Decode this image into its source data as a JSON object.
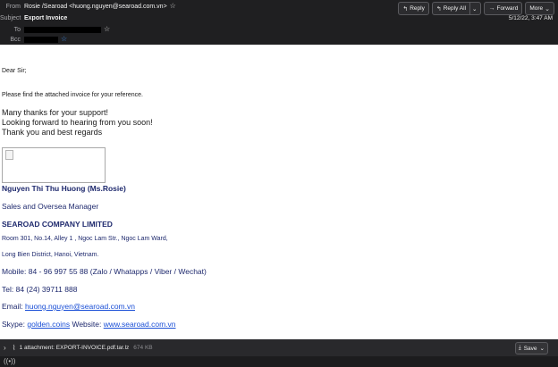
{
  "header": {
    "from_label": "From",
    "from_value": "Rosie /Searoad <huong.nguyen@searoad.com.vn>",
    "subject_label": "Subject",
    "subject_value": "Export Invoice",
    "to_label": "To",
    "bcc_label": "Bcc",
    "date": "5/12/22, 3:47 AM"
  },
  "toolbar": {
    "reply_label": "Reply",
    "reply_all_label": "Reply All",
    "forward_label": "Forward",
    "more_label": "More"
  },
  "body": {
    "greeting": "Dear Sir;",
    "intro": "Please find the attached invoice for your reference.",
    "line1": "Many thanks for your support!",
    "line2": "Looking forward to hearing from you soon!",
    "line3": "Thank you and best regards",
    "signature": {
      "name": "Nguyen Thi Thu Huong (Ms.Rosie)",
      "title": "Sales and Oversea Manager",
      "company": "SEAROAD COMPANY LIMITED",
      "address1": "Room 301, No.14, Alley 1 , Ngoc Lam Str., Ngoc Lam Ward,",
      "address2": "Long Bien District, Hanoi, Vietnam.",
      "mobile": "Mobile: 84 - 96 997 55 88 (Zalo / Whatapps / Viber / Wechat)",
      "tel": "Tel: 84 (24) 39711 888",
      "email_prefix": "Email: ",
      "email": "huong.nguyen@searoad.com.vn",
      "skype_prefix": "Skype: ",
      "skype": "golden.coins",
      "website_prefix": " Website: ",
      "website": "www.searoad.com.vn"
    }
  },
  "attachment": {
    "label": "1 attachment: EXPORT-INVOICE.pdf.tar.lz",
    "size": "674 KB",
    "save_label": "Save"
  }
}
